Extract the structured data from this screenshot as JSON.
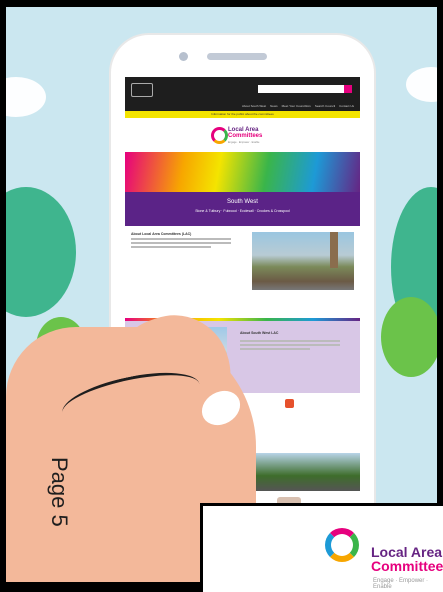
{
  "site": {
    "nav": [
      "About South West",
      "News",
      "Meet Your Councillors",
      "Search Council",
      "Contact Us"
    ],
    "notice": "Information for the public about the committees",
    "brand": {
      "line1": "Local Area",
      "line2": "Committees",
      "tagline": "Engage · Empower · Enable"
    },
    "region": {
      "name": "South West",
      "towns": "Stone & Tutbury · Fulwood · Ecclesall · Crookes & Crosspool"
    },
    "about_lac_title": "About Local Area Committees (LAC)",
    "about_sw_title": "About South West LAC"
  },
  "overlay": {
    "title1": "Local Area",
    "title2": "Committees",
    "tagline": "Engage · Empower · Enable"
  },
  "page_label": "Page 5",
  "colors": {
    "purple": "#5b2387",
    "magenta": "#e6007e",
    "green": "#3ab54a",
    "orange": "#f7a600",
    "blue": "#1d9ad6"
  }
}
